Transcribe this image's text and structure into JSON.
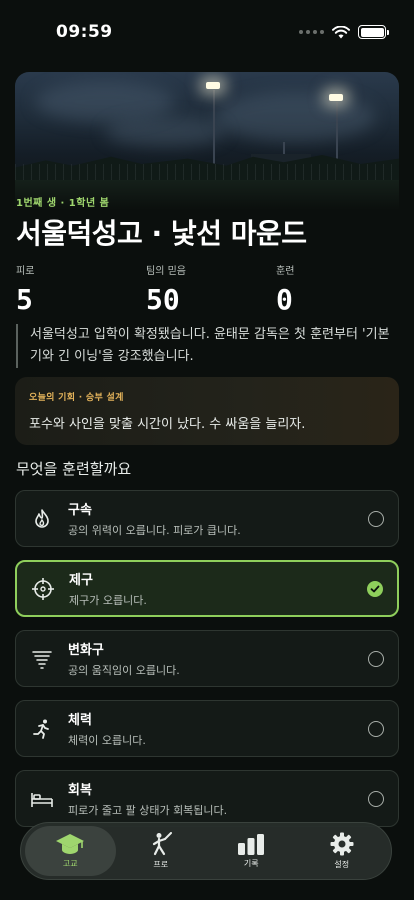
{
  "status": {
    "time": "09:59"
  },
  "hero": {
    "season": "1번째 생 · 1학년 봄",
    "title": "서울덕성고 · 낯선 마운드"
  },
  "stats": [
    {
      "label": "피로",
      "value": "5"
    },
    {
      "label": "팀의 믿음",
      "value": "50"
    },
    {
      "label": "훈련",
      "value": "0"
    }
  ],
  "story": "서울덕성고 입학이 확정됐습니다. 윤태문 감독은 첫 훈련부터 '기본기와 긴 이닝'을 강조했습니다.",
  "chance": {
    "label": "오늘의 기회 · 승부 설계",
    "text": "포수와 사인을 맞출 시간이 났다. 수 싸움을 늘리자."
  },
  "training": {
    "title": "무엇을 훈련할까요",
    "options": [
      {
        "name": "구속",
        "desc": "공의 위력이 오릅니다. 피로가 큽니다.",
        "icon": "flame-icon",
        "selected": false
      },
      {
        "name": "제구",
        "desc": "제구가 오릅니다.",
        "icon": "crosshair-icon",
        "selected": true
      },
      {
        "name": "변화구",
        "desc": "공의 움직임이 오릅니다.",
        "icon": "tornado-icon",
        "selected": false
      },
      {
        "name": "체력",
        "desc": "체력이 오릅니다.",
        "icon": "running-icon",
        "selected": false
      },
      {
        "name": "회복",
        "desc": "피로가 줄고 팔 상태가 회복됩니다.",
        "icon": "bed-icon",
        "selected": false
      }
    ]
  },
  "tabs": [
    {
      "label": "고교",
      "icon": "graduation-cap-icon",
      "active": true
    },
    {
      "label": "프로",
      "icon": "baseball-player-icon",
      "active": false
    },
    {
      "label": "기록",
      "icon": "bar-chart-icon",
      "active": false
    },
    {
      "label": "설정",
      "icon": "gear-icon",
      "active": false
    }
  ],
  "colors": {
    "accent": "#8fcf5c",
    "chance_label": "#e3b35b",
    "background": "#0b0f0d"
  }
}
